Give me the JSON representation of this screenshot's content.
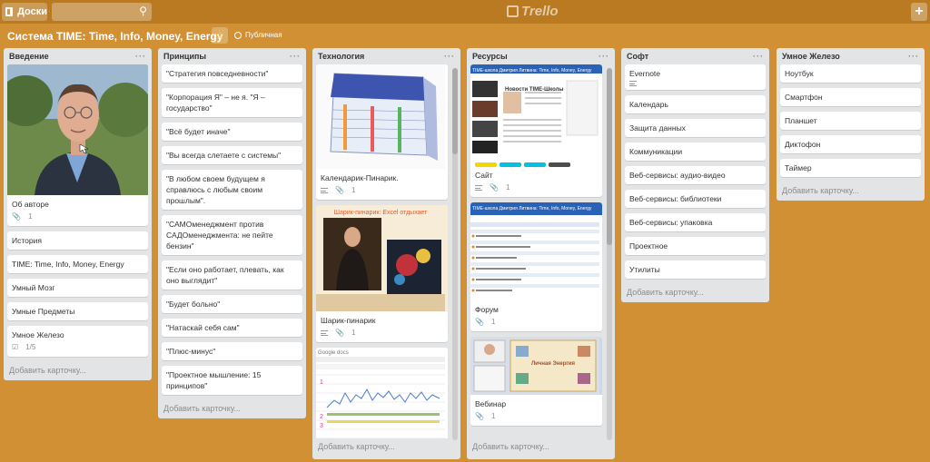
{
  "header": {
    "boards_label": "Доски",
    "logo_text": "Trello",
    "plus_label": "+"
  },
  "board": {
    "title": "Система TIME: Time, Info, Money, Energy",
    "visibility": "Публичная"
  },
  "add_card_label": "Добавить карточку...",
  "lists": [
    {
      "name": "Введение",
      "cards": [
        {
          "title": "Об авторе",
          "attachments": "1"
        },
        {
          "title": "История"
        },
        {
          "title": "TIME: Time, Info, Money, Energy"
        },
        {
          "title": "Умный Мозг"
        },
        {
          "title": "Умные Предметы"
        },
        {
          "title": "Умное Железо",
          "checklist": "1/5"
        }
      ]
    },
    {
      "name": "Принципы",
      "cards": [
        {
          "title": "\"Стратегия повседневности\""
        },
        {
          "title": "\"Корпорация Я\" – не я. \"Я – государство\""
        },
        {
          "title": "\"Всё будет иначе\""
        },
        {
          "title": "\"Вы всегда слетаете с системы\""
        },
        {
          "title": "\"В любом своем будущем я справлюсь с любым своим прошлым\"."
        },
        {
          "title": "\"САМОменеджмент против САДОменеджмента: не пейте бензин\""
        },
        {
          "title": "\"Если оно работает, плевать, как оно выглядит\""
        },
        {
          "title": "\"Будет больно\""
        },
        {
          "title": "\"Натаскай себя сам\""
        },
        {
          "title": "\"Плюс-минус\""
        },
        {
          "title": "\"Проектное мышление: 15 принципов\""
        }
      ]
    },
    {
      "name": "Технология",
      "cards": [
        {
          "title": "Календарик-Пинарик.",
          "attachments": "1"
        },
        {
          "title": "Шарик-пинарик",
          "attachments": "1",
          "cover_caption": "Шарик-пинарик: Excel отдыхает"
        },
        {
          "title": "",
          "cover_caption": "Google docs"
        }
      ]
    },
    {
      "name": "Ресурсы",
      "cards": [
        {
          "title": "Сайт",
          "attachments": "1",
          "cover_caption": "TIME-школа Дмитрия Литвина: Time, Info, Money, Energy",
          "cover_sub": "Новости TIME-Школы"
        },
        {
          "title": "Форум",
          "attachments": "1",
          "cover_caption": "TIME-школа Дмитрия Литвина: Time, Info, Money, Energy"
        },
        {
          "title": "Вебинар",
          "attachments": "1",
          "cover_caption": "Личная Энергия"
        }
      ]
    },
    {
      "name": "Софт",
      "cards": [
        {
          "title": "Evernote"
        },
        {
          "title": "Календарь"
        },
        {
          "title": "Защита данных"
        },
        {
          "title": "Коммуникации"
        },
        {
          "title": "Веб-сервисы: аудио-видео"
        },
        {
          "title": "Веб-сервисы: библиотеки"
        },
        {
          "title": "Веб-сервисы: упаковка"
        },
        {
          "title": "Проектное"
        },
        {
          "title": "Утилиты"
        }
      ]
    },
    {
      "name": "Умное Железо",
      "cards": [
        {
          "title": "Ноутбук"
        },
        {
          "title": "Смартфон"
        },
        {
          "title": "Планшет"
        },
        {
          "title": "Диктофон"
        },
        {
          "title": "Таймер"
        }
      ]
    }
  ],
  "colors": {
    "board_bg": "#d29034",
    "header_bg": "#b97a22",
    "list_bg": "#e2e4e6",
    "label_yellow": "#f2d600",
    "label_blue": "#00c2e0",
    "label_dark": "#4d4d4d"
  },
  "icons": [
    "boards-icon",
    "search-icon",
    "trello-logo-icon",
    "plus-icon",
    "star-icon",
    "globe-icon",
    "list-menu-icon",
    "attachment-icon",
    "description-icon",
    "checklist-icon"
  ]
}
